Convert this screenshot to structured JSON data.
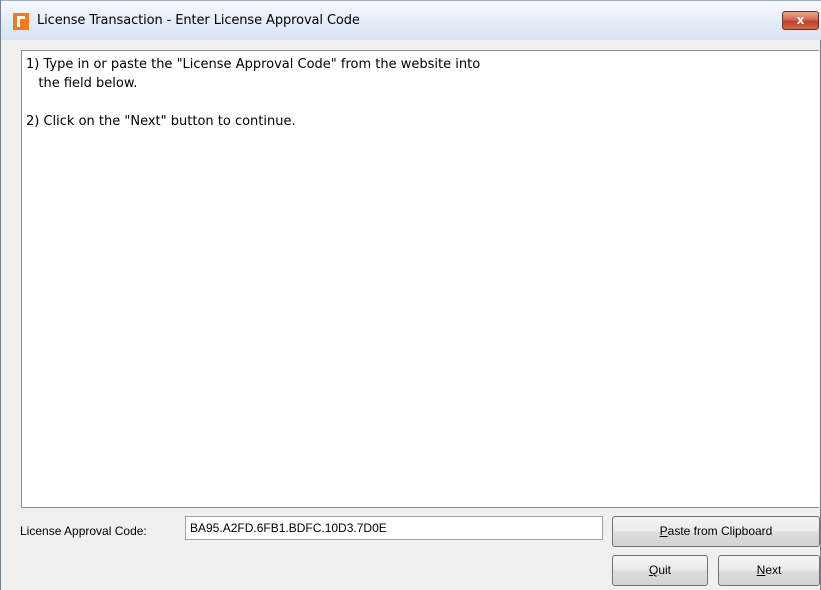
{
  "window": {
    "title": "License Transaction - Enter License Approval Code",
    "close_label": "x"
  },
  "instructions": {
    "step1_line1": "1) Type in or paste the \"License Approval Code\" from the website into",
    "step1_line2": "   the field below.",
    "step2": "2) Click on the \"Next\" button to continue."
  },
  "form": {
    "code_label": "License Approval Code:",
    "code_value": "BA95.A2FD.6FB1.BDFC.10D3.7D0E"
  },
  "buttons": {
    "paste_mnemonic": "P",
    "paste_rest": "aste from Clipboard",
    "quit_mnemonic": "Q",
    "quit_rest": "uit",
    "next_mnemonic": "N",
    "next_rest": "ext"
  },
  "colors": {
    "app_icon": "#f47a20",
    "close_button": "#c04227",
    "dialog_background": "#f0f0f0"
  },
  "icons": {
    "app": "app-logo-icon",
    "close": "close-icon"
  }
}
